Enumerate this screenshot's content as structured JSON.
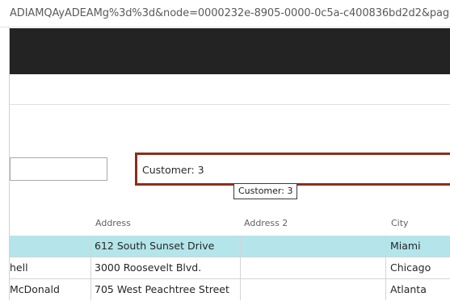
{
  "browser": {
    "url_text": "ADIAMQAyADEAMg%3d%3d&node=0000232e-8905-0000-0c5a-c400836bd2d2&page"
  },
  "form": {
    "filter_input_value": "",
    "focused_field_value": "Customer: 3",
    "tooltip_text": "Customer: 3"
  },
  "table": {
    "columns": [
      "Address",
      "Address 2",
      "City"
    ],
    "rows": [
      {
        "name": "",
        "address": "612 South Sunset Drive",
        "address2": "",
        "city": "Miami",
        "selected": true
      },
      {
        "name": "hell",
        "address": "3000 Roosevelt Blvd.",
        "address2": "",
        "city": "Chicago",
        "selected": false
      },
      {
        "name": "McDonald",
        "address": "705 West Peachtree Street",
        "address2": "",
        "city": "Atlanta",
        "selected": false
      }
    ]
  },
  "colors": {
    "header_bg": "#232323",
    "focus_border": "#8b2e1c",
    "selected_row": "#b3e5ea"
  }
}
